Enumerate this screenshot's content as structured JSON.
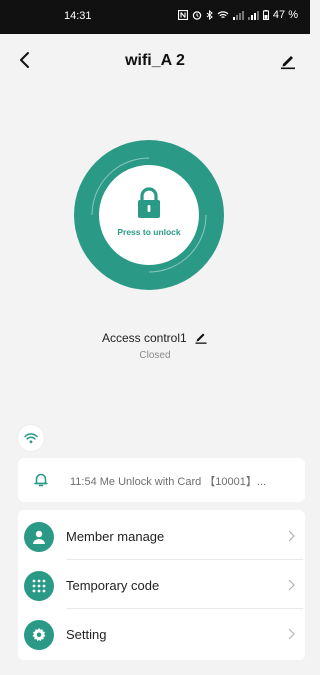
{
  "status_bar": {
    "time": "14:31",
    "battery": "47 %"
  },
  "header": {
    "title": "wifi_A 2"
  },
  "lock": {
    "label": "Press to unlock"
  },
  "device": {
    "name": "Access control1",
    "status": "Closed"
  },
  "log": {
    "text": "11:54 Me  Unlock with Card 【10001】..."
  },
  "menu": {
    "items": [
      {
        "label": "Member manage",
        "icon": "person-icon"
      },
      {
        "label": "Temporary code",
        "icon": "keypad-icon"
      },
      {
        "label": "Setting",
        "icon": "gear-icon"
      }
    ]
  },
  "colors": {
    "accent": "#2a9a86",
    "background": "#f3f3f3"
  }
}
